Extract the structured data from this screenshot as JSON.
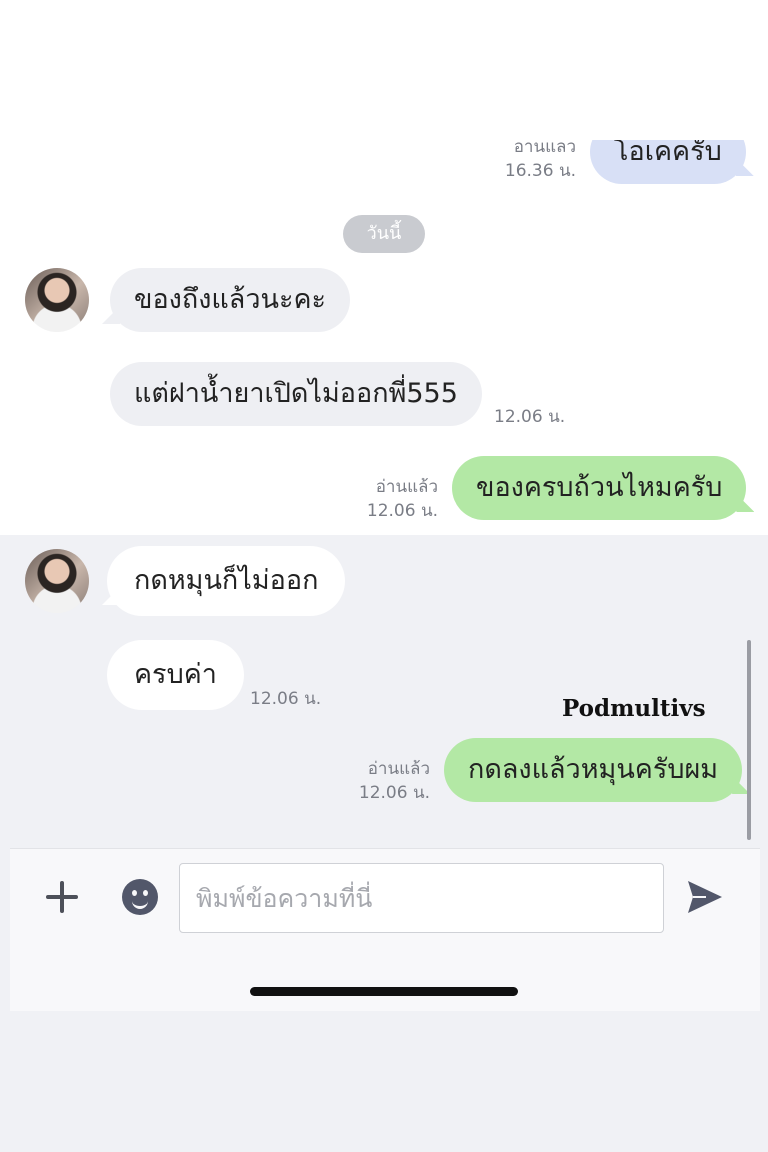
{
  "chat": {
    "date_separator": "วันนี้",
    "messages": [
      {
        "text": "โอเคครับ",
        "read_label": "อานแลว",
        "time": "16.36 น."
      },
      {
        "text": "ของถึงแล้วนะคะ"
      },
      {
        "text": "แต่ฝาน้ำยาเปิดไม่ออกพี่555",
        "time": "12.06 น."
      },
      {
        "text": "ของครบถ้วนไหมครับ",
        "read_label": "อ่านแล้ว",
        "time": "12.06 น."
      },
      {
        "text": "กดหมุนก็ไม่ออก"
      },
      {
        "text": "ครบค่า",
        "time": "12.06 น."
      },
      {
        "text": "กดลงแล้วหมุนครับผม",
        "read_label": "อ่านแล้ว",
        "time": "12.06 น."
      }
    ]
  },
  "watermark": "Podmultivs",
  "composer": {
    "placeholder": "พิมพ์ข้อความที่นี่",
    "icons": {
      "add": "plus-icon",
      "emoji": "emoji-icon",
      "send": "send-icon"
    }
  },
  "colors": {
    "incoming_bubble": "#eeeff3",
    "outgoing_blue": "#d8e0f6",
    "outgoing_green": "#b3e8a5",
    "background": "#f0f1f5"
  }
}
